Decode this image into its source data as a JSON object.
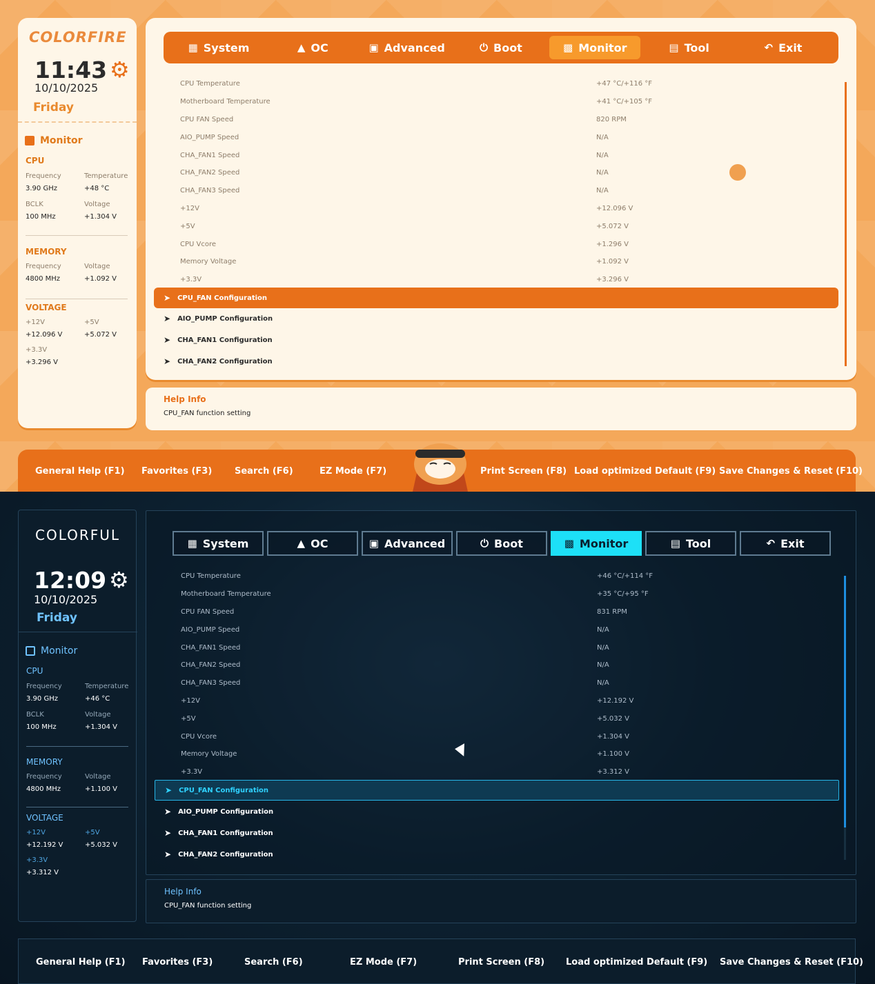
{
  "tabs": [
    {
      "label": "System",
      "icon": "grid-icon"
    },
    {
      "label": "OC",
      "icon": "rocket-icon"
    },
    {
      "label": "Advanced",
      "icon": "chip-icon"
    },
    {
      "label": "Boot",
      "icon": "power-icon"
    },
    {
      "label": "Monitor",
      "icon": "monitor-icon",
      "active": true
    },
    {
      "label": "Tool",
      "icon": "toolbox-icon"
    },
    {
      "label": "Exit",
      "icon": "reply-icon"
    }
  ],
  "monitor_labels": [
    "CPU  Temperature",
    "Motherboard Temperature",
    "CPU FAN Speed",
    "AIO_PUMP Speed",
    "CHA_FAN1 Speed",
    "CHA_FAN2 Speed",
    "CHA_FAN3 Speed",
    "+12V",
    "+5V",
    "CPU Vcore",
    "Memory Voltage",
    "+3.3V"
  ],
  "config_items": [
    "CPU_FAN Configuration",
    "AIO_PUMP Configuration",
    "CHA_FAN1 Configuration",
    "CHA_FAN2 Configuration"
  ],
  "help": {
    "title": "Help Info",
    "text": "CPU_FAN function setting"
  },
  "footer": [
    "General Help (F1)",
    "Favorites (F3)",
    "Search (F6)",
    "EZ Mode (F7)",
    "Print Screen (F8)",
    "Load optimized Default (F9)",
    "Save Changes & Reset (F10)"
  ],
  "light": {
    "brand": "COLORFIRE",
    "time": "11:43",
    "date": "10/10/2025",
    "day": "Friday",
    "sidebar": {
      "title": "Monitor",
      "cpu": {
        "heading": "CPU",
        "frequency_label": "Frequency",
        "frequency": "3.90 GHz",
        "temperature_label": "Temperature",
        "temperature": "+48 °C",
        "bclk_label": "BCLK",
        "bclk": "100 MHz",
        "voltage_label": "Voltage",
        "voltage": "+1.304 V"
      },
      "memory": {
        "heading": "MEMORY",
        "frequency_label": "Frequency",
        "frequency": "4800 MHz",
        "voltage_label": "Voltage",
        "voltage": "+1.092 V"
      },
      "voltage": {
        "heading": "VOLTAGE",
        "v12_label": "+12V",
        "v12": "+12.096 V",
        "v5_label": "+5V",
        "v5": "+5.072 V",
        "v33_label": "+3.3V",
        "v33": "+3.296 V"
      }
    },
    "monitor_values": [
      "+47 °C/+116 °F",
      "+41 °C/+105 °F",
      "820 RPM",
      "N/A",
      "N/A",
      "N/A",
      "N/A",
      "+12.096 V",
      "+5.072 V",
      "+1.296 V",
      "+1.092 V",
      "+3.296 V"
    ]
  },
  "dark": {
    "brand": "COLORFUL",
    "time": "12:09",
    "date": "10/10/2025",
    "day": "Friday",
    "sidebar": {
      "title": "Monitor",
      "cpu": {
        "heading": "CPU",
        "frequency_label": "Frequency",
        "frequency": "3.90 GHz",
        "temperature_label": "Temperature",
        "temperature": "+46 °C",
        "bclk_label": "BCLK",
        "bclk": "100 MHz",
        "voltage_label": "Voltage",
        "voltage": "+1.304 V"
      },
      "memory": {
        "heading": "MEMORY",
        "frequency_label": "Frequency",
        "frequency": "4800 MHz",
        "voltage_label": "Voltage",
        "voltage": "+1.100 V"
      },
      "voltage": {
        "heading": "VOLTAGE",
        "v12_label": "+12V",
        "v12": "+12.192 V",
        "v5_label": "+5V",
        "v5": "+5.032 V",
        "v33_label": "+3.3V",
        "v33": "+3.312 V"
      }
    },
    "monitor_values": [
      "+46 °C/+114 °F",
      "+35 °C/+95 °F",
      "831 RPM",
      "N/A",
      "N/A",
      "N/A",
      "N/A",
      "+12.192 V",
      "+5.032 V",
      "+1.304 V",
      "+1.100 V",
      "+3.312 V"
    ]
  },
  "colors": {
    "light_accent": "#e8701a",
    "light_bg": "#f4a85a",
    "dark_accent": "#1de0f7",
    "dark_bg": "#0d2232"
  }
}
